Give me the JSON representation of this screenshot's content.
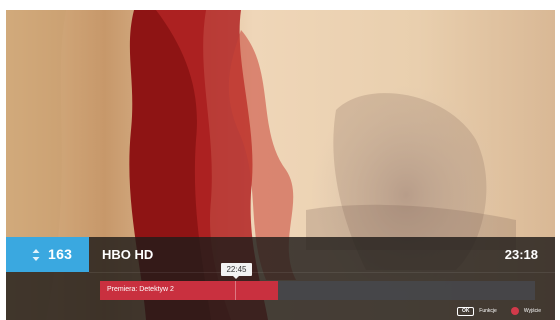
{
  "channel": {
    "number": "163",
    "name": "HBO HD",
    "switch_icon": "up-down-arrows-icon"
  },
  "clock": "23:18",
  "program": {
    "title": "Premiera: Detektyw 2",
    "marker_time": "22:45",
    "progress_fraction": 0.41,
    "marker_fraction": 0.31
  },
  "hints": {
    "ok_key": "OK",
    "ok_label": "Funkcje",
    "exit_icon": "red-button-icon",
    "exit_label": "Wyjście"
  },
  "colors": {
    "channel_accent": "#3aa8e0",
    "progress_fill": "#c9303f",
    "exit_button": "#d23a4a"
  }
}
